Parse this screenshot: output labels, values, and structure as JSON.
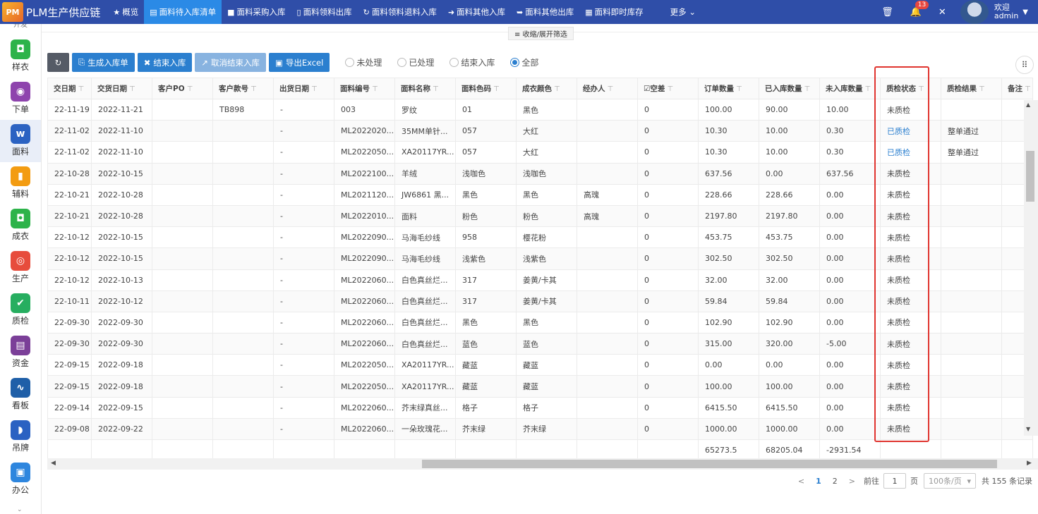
{
  "app": {
    "logo": "PM",
    "title": "PLM生产供应链"
  },
  "nav": {
    "items": [
      {
        "icon": "★",
        "label": "概览"
      },
      {
        "icon": "▤",
        "label": "面料待入库清单",
        "active": true
      },
      {
        "icon": "■",
        "label": "面料采购入库"
      },
      {
        "icon": "▯",
        "label": "面料领料出库"
      },
      {
        "icon": "↻",
        "label": "面料领料退料入库"
      },
      {
        "icon": "➜",
        "label": "面料其他入库"
      },
      {
        "icon": "➥",
        "label": "面料其他出库"
      },
      {
        "icon": "▦",
        "label": "面料即时库存"
      }
    ],
    "more_label": "更多"
  },
  "topright": {
    "notification_count": "13",
    "welcome": "欢迎",
    "user": "admin"
  },
  "sidebar": {
    "top_partial": "开发",
    "items": [
      {
        "label": "样衣",
        "color": "#2db34a",
        "glyph": "◘"
      },
      {
        "label": "下单",
        "color": "#8e44ad",
        "glyph": "◉"
      },
      {
        "label": "面料",
        "color": "#2b62c2",
        "glyph": "w",
        "active": true
      },
      {
        "label": "辅料",
        "color": "#f39c12",
        "glyph": "▮"
      },
      {
        "label": "成衣",
        "color": "#2db34a",
        "glyph": "◘"
      },
      {
        "label": "生产",
        "color": "#e74c3c",
        "glyph": "◎"
      },
      {
        "label": "质检",
        "color": "#27ae60",
        "glyph": "✔"
      },
      {
        "label": "资金",
        "color": "#7b3f98",
        "glyph": "▤"
      },
      {
        "label": "看板",
        "color": "#1f5fa8",
        "glyph": "∿"
      },
      {
        "label": "吊牌",
        "color": "#2b62c2",
        "glyph": "◗"
      },
      {
        "label": "办公",
        "color": "#2e86de",
        "glyph": "▣"
      }
    ]
  },
  "collapse_label": "≡ 收缩/展开筛选",
  "toolbar": {
    "refresh_icon": "↻",
    "buttons": [
      {
        "icon": "⎘",
        "label": "生成入库单",
        "style": "blue"
      },
      {
        "icon": "✖",
        "label": "结束入库",
        "style": "blue"
      },
      {
        "icon": "↗",
        "label": "取消结束入库",
        "style": "light"
      },
      {
        "icon": "▣",
        "label": "导出Excel",
        "style": "blue"
      }
    ],
    "radios": [
      {
        "label": "未处理",
        "checked": false
      },
      {
        "label": "已处理",
        "checked": false
      },
      {
        "label": "结束入库",
        "checked": false
      },
      {
        "label": "全部",
        "checked": true
      }
    ],
    "grid_icon": "⠿"
  },
  "table": {
    "columns": [
      {
        "label": "交日期",
        "width": 62
      },
      {
        "label": "交货日期",
        "width": 86
      },
      {
        "label": "客户PO",
        "width": 86
      },
      {
        "label": "客户款号",
        "width": 86
      },
      {
        "label": "出货日期",
        "width": 86
      },
      {
        "label": "面料编号",
        "width": 86
      },
      {
        "label": "面料名称",
        "width": 86
      },
      {
        "label": "面料色码",
        "width": 86
      },
      {
        "label": "成衣颜色",
        "width": 86
      },
      {
        "label": "经办人",
        "width": 86
      },
      {
        "label": "☑空差",
        "width": 86
      },
      {
        "label": "订单数量",
        "width": 86
      },
      {
        "label": "已入库数量",
        "width": 86
      },
      {
        "label": "未入库数量",
        "width": 86
      },
      {
        "label": "质检状态",
        "width": 86
      },
      {
        "label": "质检结果",
        "width": 86
      },
      {
        "label": "备注",
        "width": 44
      }
    ],
    "rows": [
      [
        "22-11-19",
        "2022-11-21",
        "",
        "TB898",
        "-",
        "003",
        "罗纹",
        "01",
        "黑色",
        "",
        "0",
        "100.00",
        "90.00",
        "10.00",
        "未质检",
        "",
        ""
      ],
      [
        "22-11-02",
        "2022-11-10",
        "",
        "",
        "-",
        "ML2022020...",
        "35MM单针...",
        "057",
        "大红",
        "",
        "0",
        "10.30",
        "10.00",
        "0.30",
        "已质检",
        "整单通过",
        ""
      ],
      [
        "22-11-02",
        "2022-11-10",
        "",
        "",
        "-",
        "ML2022050...",
        "XA20117YR...",
        "057",
        "大红",
        "",
        "0",
        "10.30",
        "10.00",
        "0.30",
        "已质检",
        "整单通过",
        ""
      ],
      [
        "22-10-28",
        "2022-10-15",
        "",
        "",
        "-",
        "ML2022100...",
        "羊绒",
        "浅咖色",
        "浅咖色",
        "",
        "0",
        "637.56",
        "0.00",
        "637.56",
        "未质检",
        "",
        ""
      ],
      [
        "22-10-21",
        "2022-10-28",
        "",
        "",
        "-",
        "ML2021120...",
        "JW6861 黑...",
        "黑色",
        "黑色",
        "高瑰",
        "0",
        "228.66",
        "228.66",
        "0.00",
        "未质检",
        "",
        ""
      ],
      [
        "22-10-21",
        "2022-10-28",
        "",
        "",
        "-",
        "ML2022010...",
        "面料",
        "粉色",
        "粉色",
        "高瑰",
        "0",
        "2197.80",
        "2197.80",
        "0.00",
        "未质检",
        "",
        ""
      ],
      [
        "22-10-12",
        "2022-10-15",
        "",
        "",
        "-",
        "ML2022090...",
        "马海毛纱线",
        "958",
        "樱花粉",
        "",
        "0",
        "453.75",
        "453.75",
        "0.00",
        "未质检",
        "",
        ""
      ],
      [
        "22-10-12",
        "2022-10-15",
        "",
        "",
        "-",
        "ML2022090...",
        "马海毛纱线",
        "浅紫色",
        "浅紫色",
        "",
        "0",
        "302.50",
        "302.50",
        "0.00",
        "未质检",
        "",
        ""
      ],
      [
        "22-10-12",
        "2022-10-13",
        "",
        "",
        "-",
        "ML2022060...",
        "白色真丝烂...",
        "317",
        "姜黄/卡其",
        "",
        "0",
        "32.00",
        "32.00",
        "0.00",
        "未质检",
        "",
        ""
      ],
      [
        "22-10-11",
        "2022-10-12",
        "",
        "",
        "-",
        "ML2022060...",
        "白色真丝烂...",
        "317",
        "姜黄/卡其",
        "",
        "0",
        "59.84",
        "59.84",
        "0.00",
        "未质检",
        "",
        ""
      ],
      [
        "22-09-30",
        "2022-09-30",
        "",
        "",
        "-",
        "ML2022060...",
        "白色真丝烂...",
        "黑色",
        "黑色",
        "",
        "0",
        "102.90",
        "102.90",
        "0.00",
        "未质检",
        "",
        ""
      ],
      [
        "22-09-30",
        "2022-09-30",
        "",
        "",
        "-",
        "ML2022060...",
        "白色真丝烂...",
        "蓝色",
        "蓝色",
        "",
        "0",
        "315.00",
        "320.00",
        "-5.00",
        "未质检",
        "",
        ""
      ],
      [
        "22-09-15",
        "2022-09-18",
        "",
        "",
        "-",
        "ML2022050...",
        "XA20117YR...",
        "藏蓝",
        "藏蓝",
        "",
        "0",
        "0.00",
        "0.00",
        "0.00",
        "未质检",
        "",
        ""
      ],
      [
        "22-09-15",
        "2022-09-18",
        "",
        "",
        "-",
        "ML2022050...",
        "XA20117YR...",
        "藏蓝",
        "藏蓝",
        "",
        "0",
        "100.00",
        "100.00",
        "0.00",
        "未质检",
        "",
        ""
      ],
      [
        "22-09-14",
        "2022-09-15",
        "",
        "",
        "-",
        "ML2022060...",
        "芥末绿真丝...",
        "格子",
        "格子",
        "",
        "0",
        "6415.50",
        "6415.50",
        "0.00",
        "未质检",
        "",
        ""
      ],
      [
        "22-09-08",
        "2022-09-22",
        "",
        "",
        "-",
        "ML2022060...",
        "一朵玫瑰花...",
        "芥末绿",
        "芥末绿",
        "",
        "0",
        "1000.00",
        "1000.00",
        "0.00",
        "未质检",
        "",
        ""
      ]
    ],
    "summary": [
      "",
      "",
      "",
      "",
      "",
      "",
      "",
      "",
      "",
      "",
      "",
      "65273.5",
      "68205.04",
      "-2931.54",
      "",
      "",
      ""
    ]
  },
  "pagination": {
    "prev": "<",
    "pages": [
      "1",
      "2"
    ],
    "active": "1",
    "next": ">",
    "goto_prefix": "前往",
    "goto_value": "1",
    "goto_suffix": "页",
    "page_size": "100条/页",
    "total": "共 155 条记录"
  },
  "colors": {
    "topbar": "#2f4ea8",
    "active_nav": "#2b8ae6",
    "accent": "#2b7fcf",
    "highlight": "#e0342f"
  }
}
